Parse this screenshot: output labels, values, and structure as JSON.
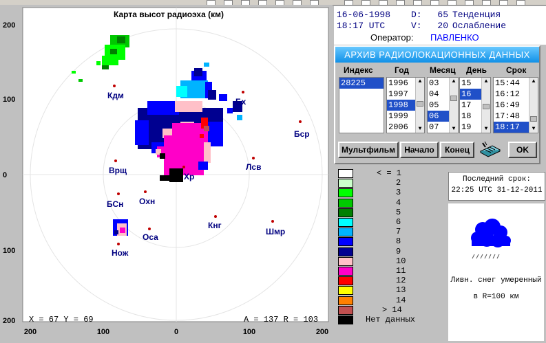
{
  "map": {
    "title": "Карта высот радиоэха (км)",
    "axis_left": [
      "200",
      "100",
      "0",
      "100",
      "200"
    ],
    "axis_bottom": [
      "200",
      "100",
      "0",
      "100",
      "200"
    ],
    "stations": [
      {
        "label": "Кдм"
      },
      {
        "label": "Бх"
      },
      {
        "label": "Бср"
      },
      {
        "label": "Врщ"
      },
      {
        "label": "Лсв"
      },
      {
        "label": "Хр"
      },
      {
        "label": "Охн"
      },
      {
        "label": "БСн"
      },
      {
        "label": "Кнг"
      },
      {
        "label": "Шмр"
      },
      {
        "label": "Оса"
      },
      {
        "label": "Нож"
      }
    ],
    "status_xy": "X =  67  Y =  69",
    "status_ar": "A = 137  R = 103"
  },
  "info": {
    "date": "16-06-1998",
    "d_label": "D:",
    "d_value": "65",
    "trend": "Тенденция",
    "time": "18:17 UTC",
    "v_label": "V:",
    "v_value": "20",
    "attenuation": "Ослабление",
    "operator_label": "Оператор:",
    "operator_name": "ПАВЛЕНКО"
  },
  "archive": {
    "title": "АРХИВ  РАДИОЛОКАЦИОННЫХ ДАННЫХ",
    "headers": {
      "index": "Индекс",
      "year": "Год",
      "month": "Месяц",
      "day": "День",
      "term": "Срок"
    },
    "index": [
      "28225"
    ],
    "years": [
      "1996",
      "1997",
      "1998",
      "1999",
      "2006"
    ],
    "months": [
      "03",
      "04",
      "05",
      "06",
      "07"
    ],
    "days": [
      "15",
      "16",
      "17",
      "18",
      "19"
    ],
    "terms": [
      "15:44",
      "16:12",
      "16:49",
      "17:48",
      "18:17"
    ],
    "selected": {
      "index": "28225",
      "year": "1998",
      "month": "06",
      "day": "16",
      "term": "18:17"
    },
    "buttons": {
      "multfilm": "Мультфильм",
      "start": "Начало",
      "end": "Конец",
      "ok": "OK"
    }
  },
  "legend": [
    {
      "color": "#ffffff",
      "label": "< = 1"
    },
    {
      "color": "#ccffcc",
      "label": "2"
    },
    {
      "color": "#00ff00",
      "label": "3"
    },
    {
      "color": "#00c800",
      "label": "4"
    },
    {
      "color": "#008000",
      "label": "5"
    },
    {
      "color": "#00ffff",
      "label": "6"
    },
    {
      "color": "#00b4ff",
      "label": "7"
    },
    {
      "color": "#0000ff",
      "label": "8"
    },
    {
      "color": "#000090",
      "label": "9"
    },
    {
      "color": "#ffc0c8",
      "label": "10"
    },
    {
      "color": "#ff00c8",
      "label": "11"
    },
    {
      "color": "#ff0000",
      "label": "12"
    },
    {
      "color": "#ffff00",
      "label": "13"
    },
    {
      "color": "#ff8000",
      "label": "14"
    },
    {
      "color": "#c05050",
      "label": "> 14"
    },
    {
      "color": "#000000",
      "label": "Нет данных"
    }
  ],
  "last": {
    "title": "Последний срок:",
    "value": "22:25 UTC 31-12-2011"
  },
  "weather": {
    "line1": "Ливн. снег умеренный",
    "line2": "в R=100 км",
    "icon": "snow-shower-icon"
  }
}
